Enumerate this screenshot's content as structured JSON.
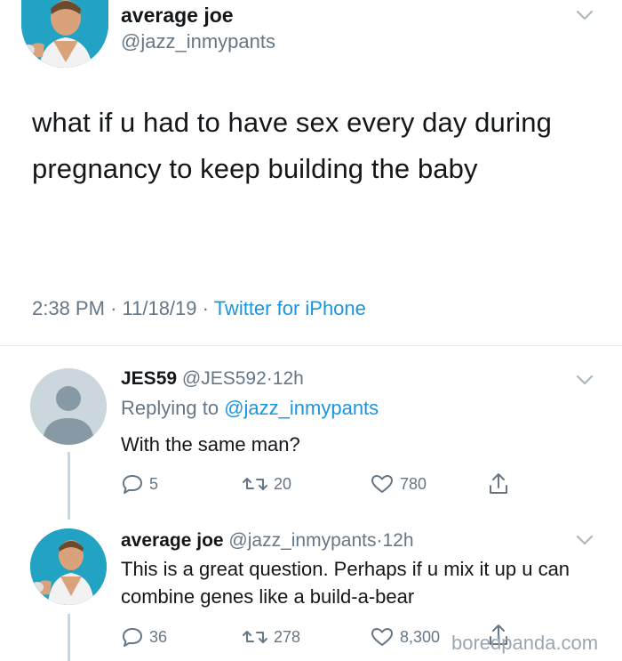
{
  "main_tweet": {
    "display_name": "average joe",
    "handle": "@jazz_inmypants",
    "text": "what if u had to have sex every day during pregnancy to keep building the baby",
    "time": "2:38 PM",
    "date": "11/18/19",
    "separator": "·",
    "source": "Twitter for iPhone"
  },
  "replies": [
    {
      "display_name": "JES59",
      "handle": "@JES592",
      "time_ago": "12h",
      "separator": "·",
      "replying_prefix": "Replying to",
      "replying_handle": "@jazz_inmypants",
      "text": "With the same man?",
      "replies": "5",
      "retweets": "20",
      "likes": "780"
    },
    {
      "display_name": "average joe",
      "handle": "@jazz_inmypants",
      "time_ago": "12h",
      "separator": "·",
      "text": "This is a great question. Perhaps if u mix it up u can combine genes like a build-a-bear",
      "replies": "36",
      "retweets": "278",
      "likes": "8,300"
    }
  ],
  "watermark": "boredpanda.com",
  "colors": {
    "text": "#14171a",
    "muted": "#657786",
    "link": "#1b95e0",
    "avatar_bg": "#1d9fc2",
    "default_avatar": "#ccd6dd"
  },
  "icons": [
    "chevron-down-icon",
    "reply-icon",
    "retweet-icon",
    "like-icon",
    "share-icon",
    "default-avatar-icon"
  ]
}
